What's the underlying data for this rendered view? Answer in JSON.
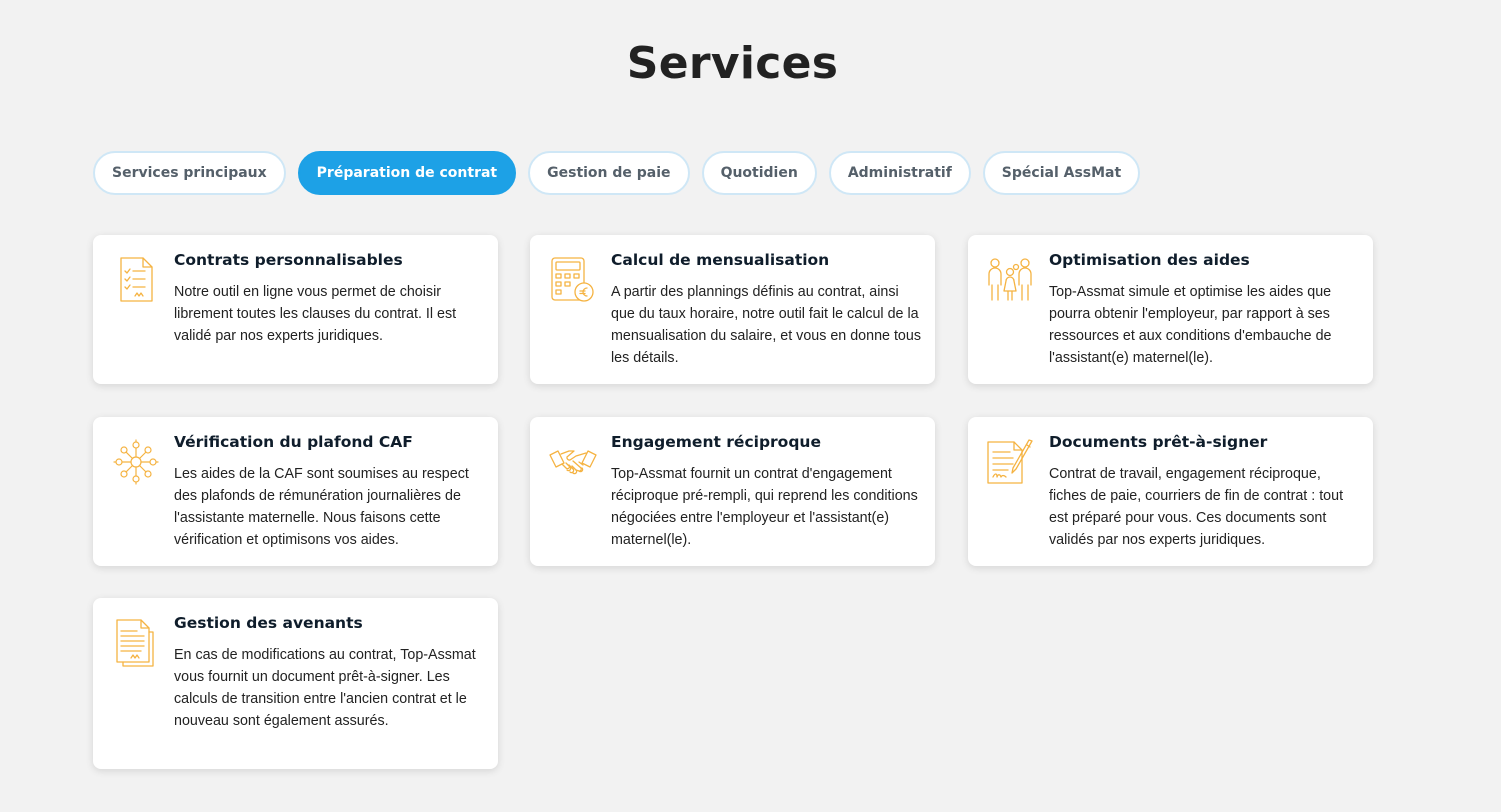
{
  "page": {
    "title": "Services"
  },
  "tabs": [
    {
      "label": "Services principaux",
      "active": false
    },
    {
      "label": "Préparation de contrat",
      "active": true
    },
    {
      "label": "Gestion de paie",
      "active": false
    },
    {
      "label": "Quotidien",
      "active": false
    },
    {
      "label": "Administratif",
      "active": false
    },
    {
      "label": "Spécial AssMat",
      "active": false
    }
  ],
  "colors": {
    "accent": "#1da1e6",
    "icon": "#f5b342",
    "background": "#f2f2f2"
  },
  "cards": [
    {
      "icon": "contract-icon",
      "title": "Contrats personnalisables",
      "text": "Notre outil en ligne vous permet de choisir librement toutes les clauses du contrat. Il est validé par nos experts juridiques."
    },
    {
      "icon": "calculator-euro-icon",
      "title": "Calcul de mensualisation",
      "text": "A partir des plannings définis au contrat, ainsi que du taux horaire, notre outil fait le calcul de la mensualisation du salaire, et vous en donne tous les détails."
    },
    {
      "icon": "family-icon",
      "title": "Optimisation des aides",
      "text": "Top-Assmat simule et optimise les aides que pourra obtenir l'employeur, par rapport à ses ressources et aux conditions d'embauche de l'assistant(e) maternel(le)."
    },
    {
      "icon": "network-icon",
      "title": "Vérification du plafond CAF",
      "text": "Les aides de la CAF sont soumises au respect des plafonds de rémunération journalières de l'assistante maternelle. Nous faisons cette vérification et optimisons vos aides."
    },
    {
      "icon": "handshake-icon",
      "title": "Engagement réciproque",
      "text": "Top-Assmat fournit un contrat d'engagement réciproque pré-rempli, qui reprend les conditions négociées entre l'employeur et l'assistant(e) maternel(le)."
    },
    {
      "icon": "signed-document-icon",
      "title": "Documents prêt-à-signer",
      "text": "Contrat de travail, engagement réciproque, fiches de paie, courriers de fin de contrat : tout est préparé pour vous. Ces documents sont validés par nos experts juridiques."
    },
    {
      "icon": "amendment-document-icon",
      "title": "Gestion des avenants",
      "text": "En cas de modifications au contrat, Top-Assmat vous fournit un document prêt-à-signer. Les calculs de transition entre l'ancien contrat et le nouveau sont également assurés."
    }
  ]
}
